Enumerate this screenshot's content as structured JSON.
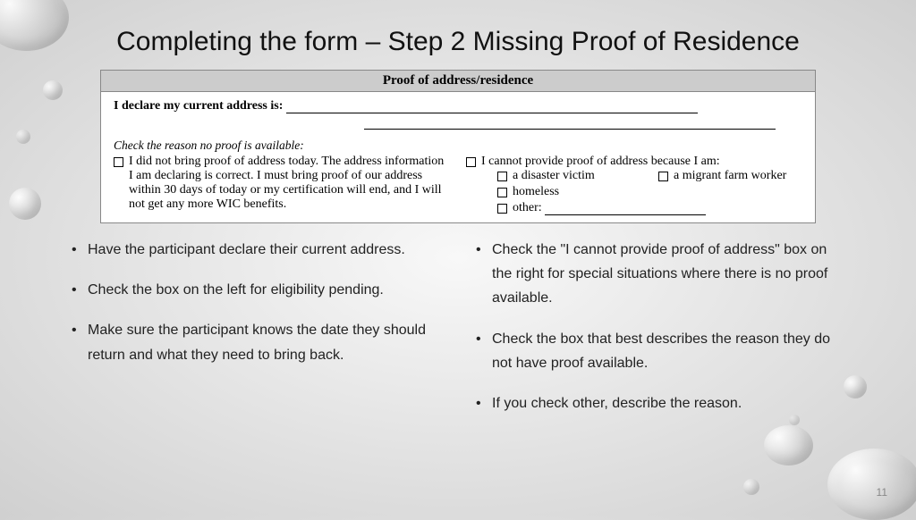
{
  "title": "Completing the form – Step 2 Missing Proof of Residence",
  "form": {
    "header": "Proof of address/residence",
    "declare_label": "I declare my current address is:",
    "check_reason_label": "Check the reason no proof is available:",
    "left_option": "I did not bring proof of address today. The address information I am declaring is correct. I must bring proof of our address within 30 days of today or my certification will end, and I will not get any more WIC benefits.",
    "right_option": "I cannot provide proof of address because I am:",
    "sub_disaster": "a disaster victim",
    "sub_migrant": "a migrant farm worker",
    "sub_homeless": "homeless",
    "sub_other": "other:"
  },
  "left_bullets": [
    "Have the participant declare their current address.",
    "Check the box on the left for eligibility pending.",
    "Make sure the participant knows the date they should return and what they need to bring back."
  ],
  "right_bullets": [
    "Check the \"I cannot provide proof of address\" box on the right for special situations where there is no proof available.",
    "Check the box that best describes the reason they do not have proof available.",
    "If you check other, describe the reason."
  ],
  "page_number": "11"
}
